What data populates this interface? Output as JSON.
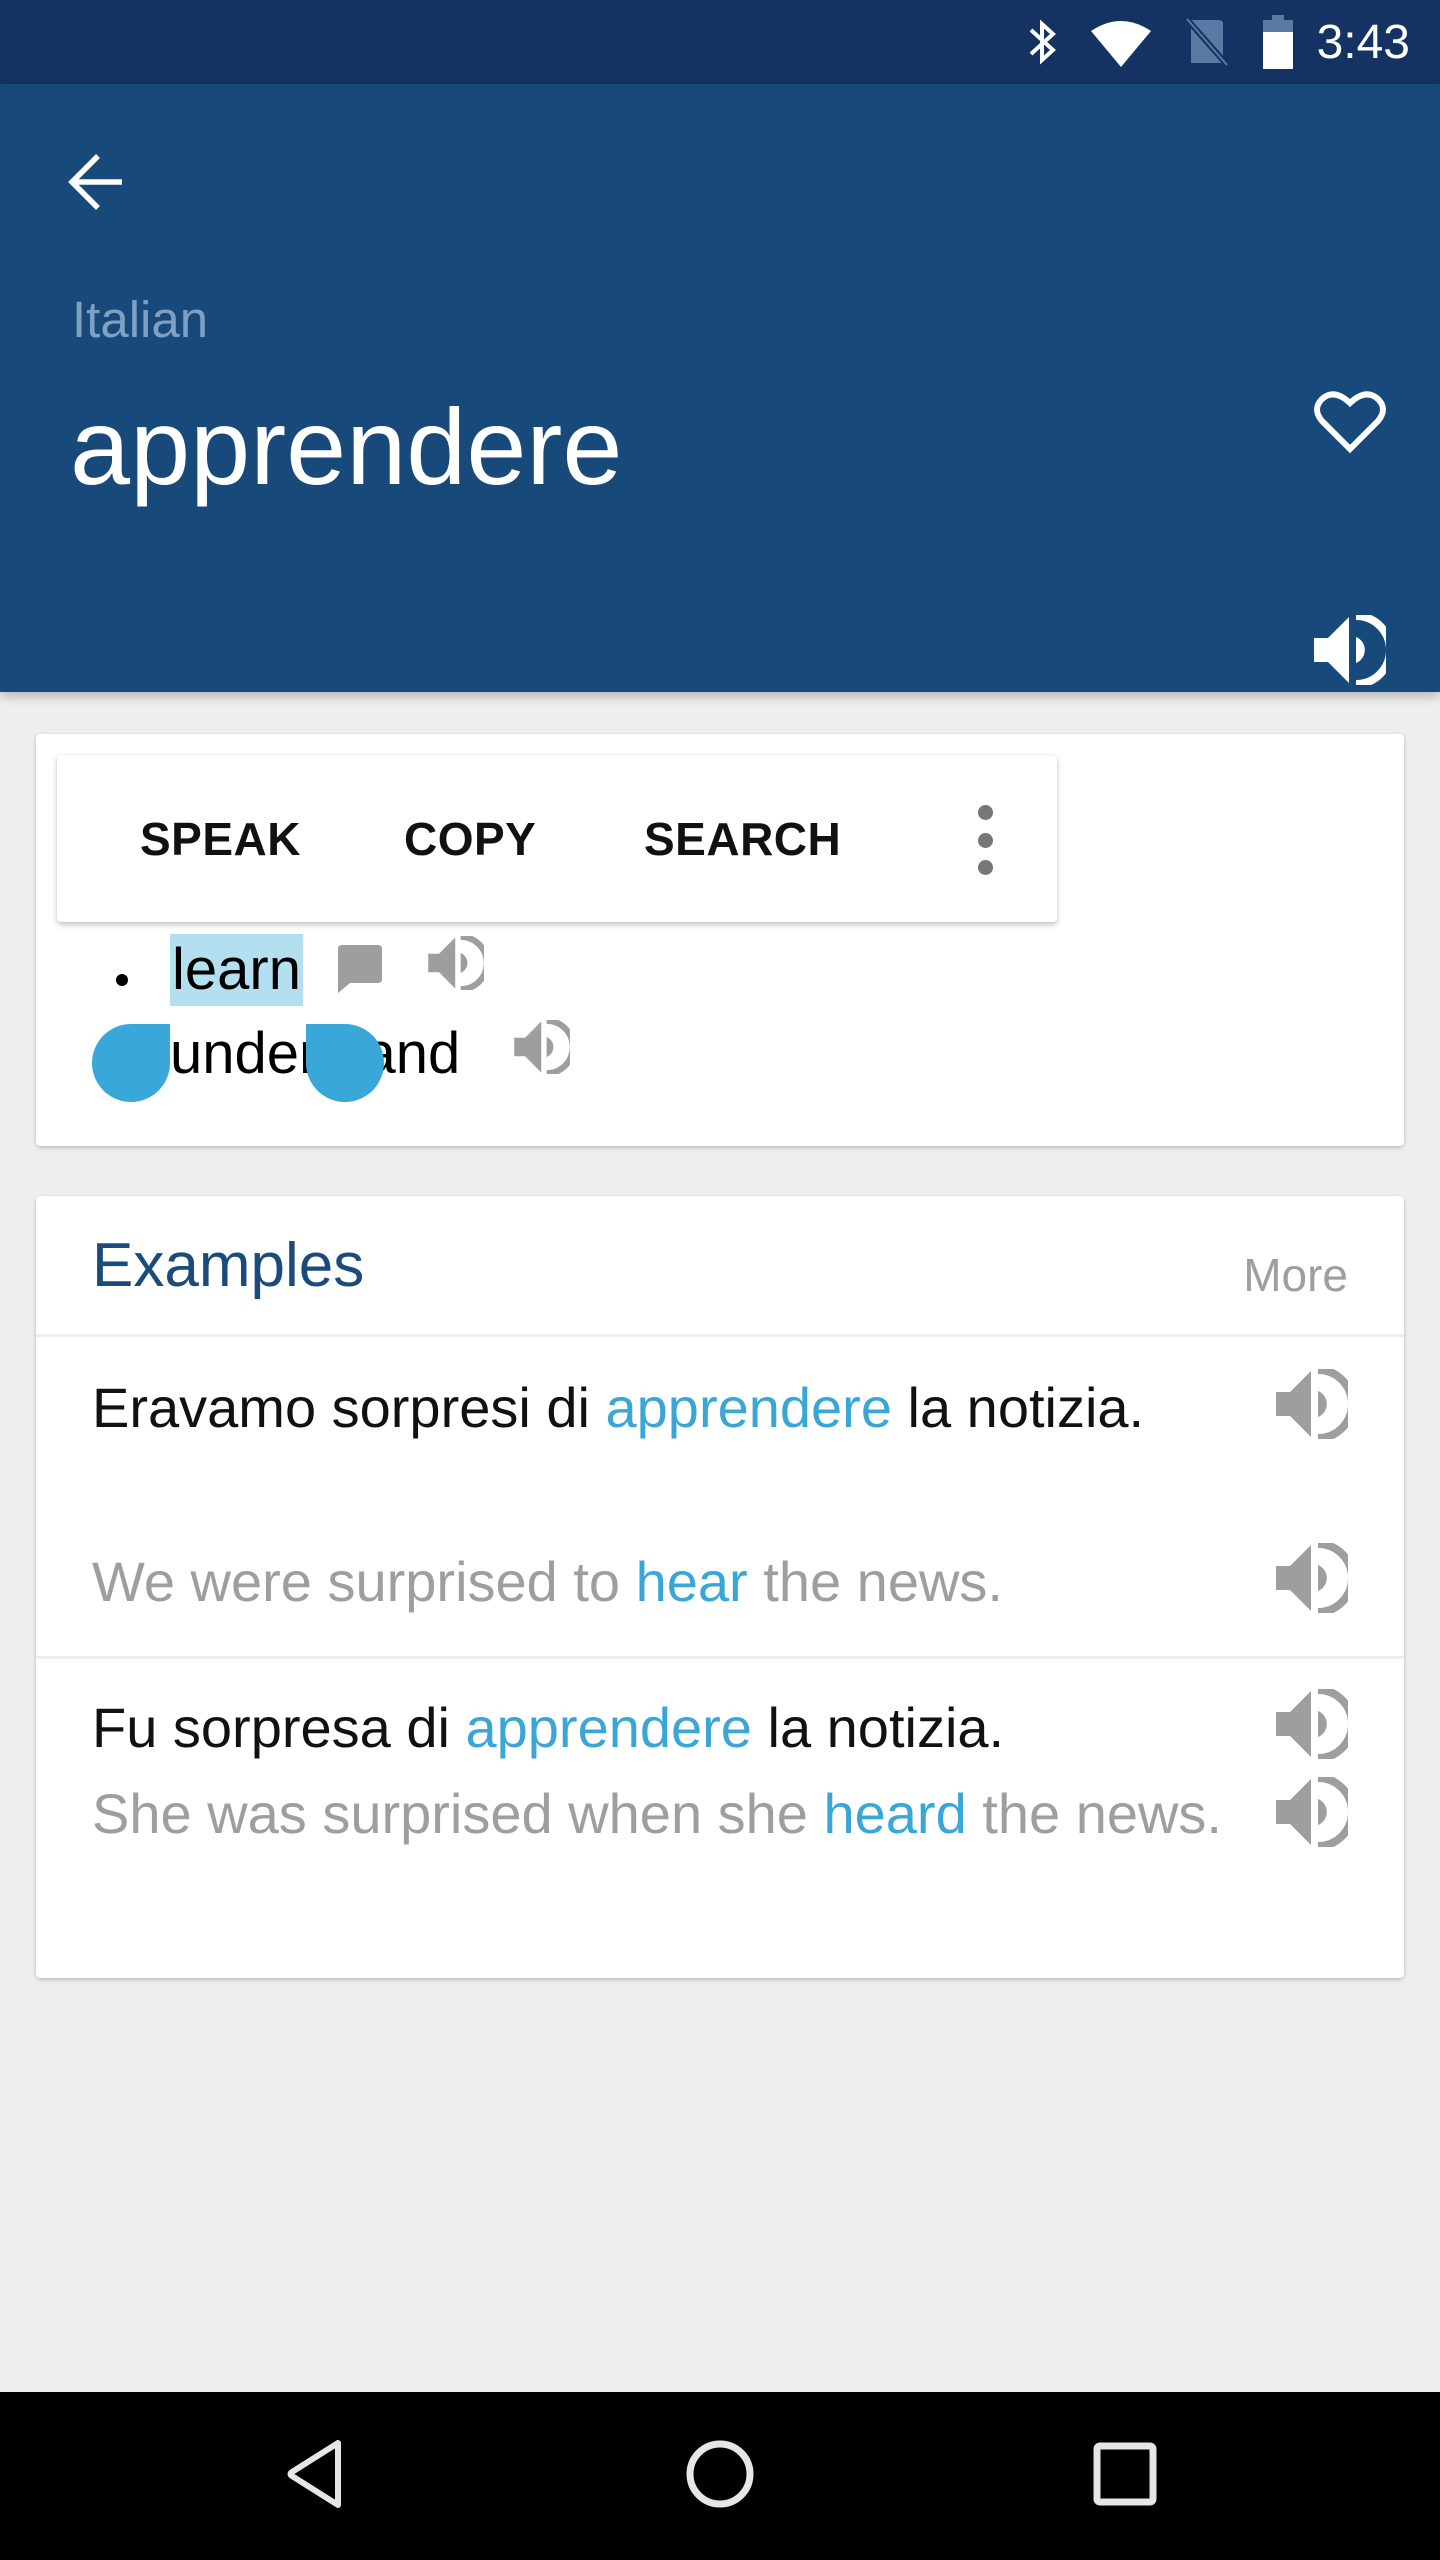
{
  "status_bar": {
    "time": "3:43",
    "icons": [
      "bluetooth-icon",
      "wifi-icon",
      "no-sim-icon",
      "battery-icon"
    ]
  },
  "header": {
    "back_icon": "arrow-left-icon",
    "language": "Italian",
    "word": "apprendere",
    "favorite_icon": "heart-outline-icon",
    "speaker_icon": "volume-icon"
  },
  "colors": {
    "status_bar": "#143362",
    "header": "#174a7a",
    "background": "#eeeeee",
    "accent": "#3aa6d6",
    "selection": "#b3dff0",
    "selection_handle": "#39a8d9",
    "section_title": "#1a4b7b",
    "secondary_text": "#9e9e9e"
  },
  "selection_toolbar": {
    "items": [
      {
        "label": "SPEAK"
      },
      {
        "label": "COPY"
      },
      {
        "label": "SEARCH"
      }
    ],
    "overflow_icon": "more-vertical-icon"
  },
  "translations": [
    {
      "text": "learn",
      "selected": true,
      "icons": [
        "comment-icon",
        "volume-icon"
      ]
    },
    {
      "text": "understand",
      "selected": false,
      "icons": [
        "volume-icon"
      ]
    }
  ],
  "examples": {
    "title": "Examples",
    "more_label": "More",
    "items": [
      {
        "source": {
          "before": "Eravamo sorpresi di ",
          "highlight": "apprendere",
          "after": " la notizia."
        },
        "target": {
          "before": "We were surprised to ",
          "highlight": "hear",
          "after": " the news."
        }
      },
      {
        "source": {
          "before": "Fu sorpresa di ",
          "highlight": "apprendere",
          "after": " la notizia."
        },
        "target": {
          "before": "She was surprised when she ",
          "highlight": "heard",
          "after": " the news."
        }
      }
    ]
  },
  "nav_bar": {
    "buttons": [
      "back-triangle-icon",
      "home-circle-icon",
      "recents-square-icon"
    ]
  }
}
